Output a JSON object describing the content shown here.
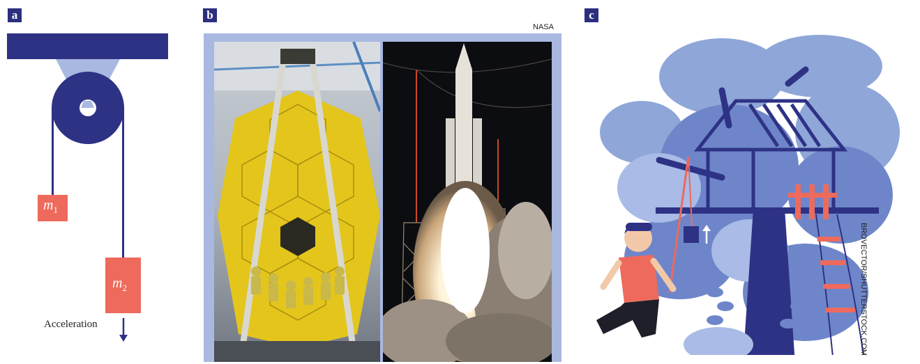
{
  "panels": {
    "a": {
      "label": "a",
      "mass1_symbol": "m",
      "mass1_subscript": "1",
      "mass2_symbol": "m",
      "mass2_subscript": "2",
      "acceleration_label": "Acceleration",
      "colors": {
        "navy": "#2e3285",
        "salmon": "#ee6a5c",
        "light_blue": "#a9b8e0"
      }
    },
    "b": {
      "label": "b",
      "credit": "NASA"
    },
    "c": {
      "label": "c",
      "credit": "BROVECTOR/SHUTTERSTOCK.COM"
    }
  }
}
